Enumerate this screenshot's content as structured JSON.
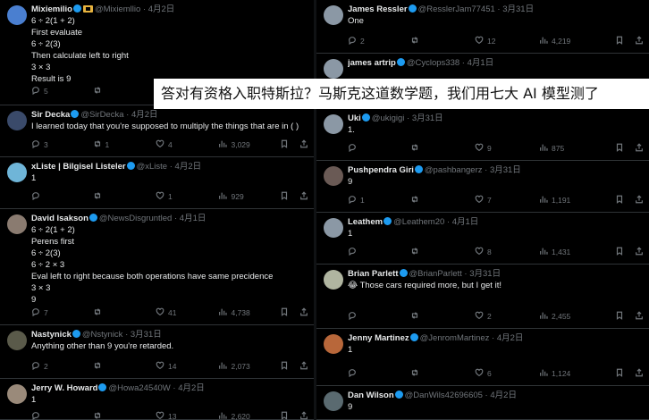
{
  "overlay_caption": "答对有资格入职特斯拉？马斯克这道数学题，我们用七大 AI 模型测了",
  "left_tweets": [
    {
      "name": "Mixiemilio",
      "handle": "@Mixiemllio",
      "date": "4月2日",
      "gold": true,
      "avatar_color": "#4a7fd0",
      "lines": [
        "6 ÷ 2(1 + 2)",
        "First evaluate",
        "6 ÷ 2(3)",
        "Then calculate left to right",
        "3 × 3",
        "Result is 9"
      ],
      "stats": {
        "reply": "5",
        "retweet": "",
        "like": "",
        "views": ""
      }
    },
    {
      "name": "Sir Decka",
      "handle": "@SirDecka",
      "date": "4月2日",
      "avatar_color": "#3a4a6a",
      "lines": [
        "I learned today that you're supposed to multiply the things that are in (   )"
      ],
      "stats": {
        "reply": "3",
        "retweet": "1",
        "like": "4",
        "views": "3,029"
      }
    },
    {
      "name": "xListe | Bilgisel Listeler",
      "handle": "@xListe",
      "date": "4月2日",
      "avatar_color": "#6fb5d8",
      "lines": [
        "1"
      ],
      "stats": {
        "reply": "",
        "retweet": "",
        "like": "1",
        "views": "929"
      }
    },
    {
      "name": "David Isakson",
      "handle": "@NewsDisgruntled",
      "date": "4月1日",
      "avatar_color": "#8a7b70",
      "lines": [
        "6 ÷ 2(1 + 2)",
        "Perens first",
        "6 ÷ 2(3)",
        "6 ÷ 2 × 3",
        "Eval left to right because both operations have same precidence",
        "3 × 3",
        "9"
      ],
      "stats": {
        "reply": "7",
        "retweet": "",
        "like": "41",
        "views": "4,738"
      }
    },
    {
      "name": "Nastynick",
      "handle": "@Nstynick",
      "date": "3月31日",
      "avatar_color": "#5a5a4a",
      "lines": [
        "Anything other than 9 you're retarded."
      ],
      "stats": {
        "reply": "2",
        "retweet": "",
        "like": "14",
        "views": "2,073"
      }
    },
    {
      "name": "Jerry W. Howard",
      "handle": "@Howa24540W",
      "date": "4月2日",
      "avatar_color": "#9a8a7a",
      "lines": [
        "1"
      ],
      "stats": {
        "reply": "",
        "retweet": "",
        "like": "13",
        "views": "2,620"
      }
    }
  ],
  "right_tweets": [
    {
      "name": "James Ressler",
      "handle": "@ResslerJam77451",
      "date": "3月31日",
      "avatar_color": "#8b98a5",
      "lines": [
        "One"
      ],
      "stats": {
        "reply": "2",
        "retweet": "",
        "like": "12",
        "views": "4,219"
      }
    },
    {
      "name": "james artrip",
      "handle": "@Cyclops338",
      "date": "4月1日",
      "avatar_color": "#8b98a5",
      "lines": [],
      "stats": {
        "reply": "",
        "retweet": "",
        "like": "",
        "views": ""
      }
    },
    {
      "name": "Uki",
      "handle": "@ukigigi",
      "date": "3月31日",
      "avatar_color": "#8b98a5",
      "lines": [
        "1."
      ],
      "stats": {
        "reply": "",
        "retweet": "",
        "like": "9",
        "views": "875"
      }
    },
    {
      "name": "Pushpendra Giri",
      "handle": "@pashbangerz",
      "date": "3月31日",
      "avatar_color": "#6a5a55",
      "lines": [
        "9"
      ],
      "stats": {
        "reply": "1",
        "retweet": "",
        "like": "7",
        "views": "1,191"
      }
    },
    {
      "name": "Leathem",
      "handle": "@Leathem20",
      "date": "4月1日",
      "avatar_color": "#8b98a5",
      "lines": [
        "1"
      ],
      "stats": {
        "reply": "",
        "retweet": "",
        "like": "8",
        "views": "1,431"
      }
    },
    {
      "name": "Brian Parlett",
      "handle": "@BrianParlett",
      "date": "3月31日",
      "avatar_color": "#b0b5a0",
      "lines": [
        "😂 Those cars required more, but I get it!"
      ],
      "stats": {
        "reply": "",
        "retweet": "",
        "like": "2",
        "views": "2,455"
      }
    },
    {
      "name": "Jenny Martinez",
      "handle": "@JenromMartinez",
      "date": "4月2日",
      "avatar_color": "#b8673a",
      "lines": [
        "1"
      ],
      "stats": {
        "reply": "",
        "retweet": "",
        "like": "6",
        "views": "1,124"
      }
    },
    {
      "name": "Dan Wilson",
      "handle": "@DanWils42696605",
      "date": "4月2日",
      "avatar_color": "#5a6a70",
      "lines": [
        "9"
      ],
      "stats": {
        "reply": "",
        "retweet": "",
        "like": "",
        "views": ""
      }
    }
  ]
}
